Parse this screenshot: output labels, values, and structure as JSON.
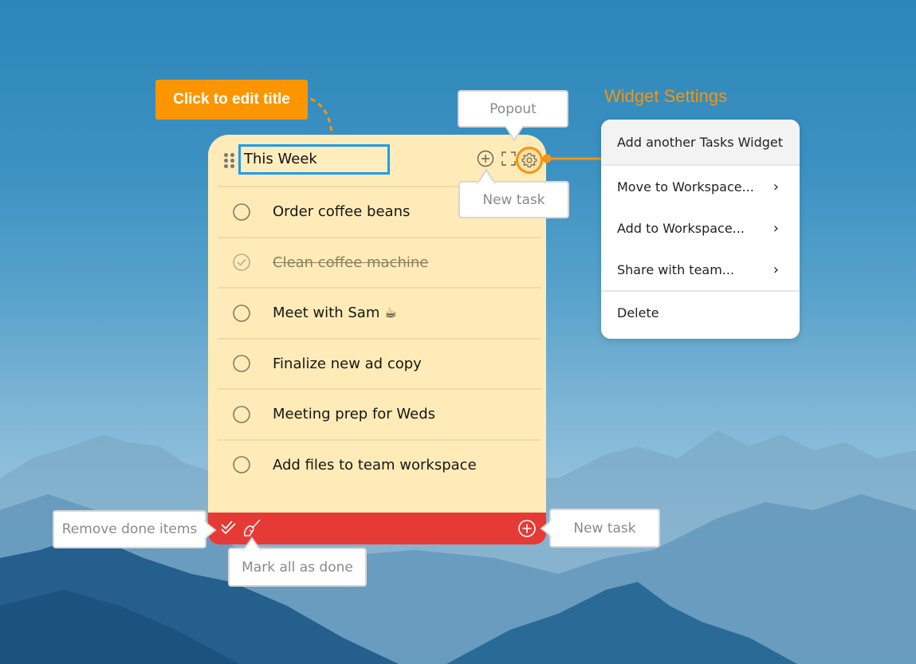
{
  "annotations": {
    "edit_title": "Click to edit title",
    "popout": "Popout",
    "new_task_header": "New task",
    "widget_settings": "Widget Settings",
    "remove_done": "Remove done items",
    "mark_all_done": "Mark all as done",
    "new_task_footer": "New task"
  },
  "widget": {
    "title": "This Week",
    "tasks": [
      {
        "label": "Order coffee beans",
        "done": false
      },
      {
        "label": "Clean coffee machine",
        "done": true
      },
      {
        "label": "Meet with Sam ☕",
        "done": false
      },
      {
        "label": "Finalize new ad copy",
        "done": false
      },
      {
        "label": "Meeting prep for Weds",
        "done": false
      },
      {
        "label": "Add files to team workspace",
        "done": false
      }
    ],
    "icons": {
      "drag": "drag-handle-icon",
      "add": "plus-circle-icon",
      "popout": "expand-icon",
      "settings": "gear-icon",
      "remove_done": "double-check-icon",
      "mark_all": "broom-icon",
      "footer_add": "plus-circle-icon"
    }
  },
  "menu": {
    "items": [
      {
        "label": "Add another Tasks Widget",
        "submenu": false
      },
      {
        "label": "Move to Workspace...",
        "submenu": true
      },
      {
        "label": "Add to Workspace...",
        "submenu": true
      },
      {
        "label": "Share with team...",
        "submenu": true
      },
      {
        "label": "Delete",
        "submenu": false
      }
    ],
    "chevron": "›"
  },
  "colors": {
    "accent_orange": "#fb9600",
    "widget_bg": "#feebb7",
    "footer_red": "#e53a36",
    "title_focus": "#1b9df0"
  }
}
